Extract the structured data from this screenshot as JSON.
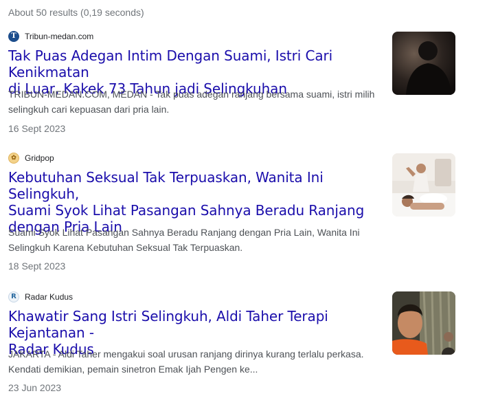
{
  "stats": "About 50 results (0,19 seconds)",
  "results": [
    {
      "favicon_letter": "T",
      "source": "Tribun-medan.com",
      "title_lines": [
        "Tak Puas Adegan Intim Dengan Suami, Istri Cari Kenikmatan",
        "di Luar, Kakek 73 Tahun jadi Selingkuhan"
      ],
      "snippet_lines": [
        "TRIBUN-MEDAN.COM, MEDAN - Tak puas adegan ranjang bersama suami, istri milih",
        "selingkuh cari kepuasan dari pria lain."
      ],
      "date": "16 Sept 2023",
      "thumbnail": "man-silhouette-photo"
    },
    {
      "favicon_letter": "✿",
      "source": "Gridpop",
      "title_lines": [
        "Kebutuhan Seksual Tak Terpuaskan, Wanita Ini Selingkuh,",
        "Suami Syok Lihat Pasangan Sahnya Beradu Ranjang",
        "dengan Pria Lain"
      ],
      "snippet_lines": [
        "Suami Syok Lihat Pasangan Sahnya Beradu Ranjang dengan Pria Lain, Wanita Ini",
        "Selingkuh Karena Kebutuhan Seksual Tak Terpuaskan."
      ],
      "date": "18 Sept 2023",
      "thumbnail": "bedroom-photo"
    },
    {
      "favicon_letter": "R",
      "source": "Radar Kudus",
      "title_lines": [
        "Khawatir Sang Istri Selingkuh, Aldi Taher Terapi Kejantanan -",
        "Radar Kudus"
      ],
      "snippet_lines": [
        "JAKARTA - Aldi Taher mengakui soal urusan ranjang dirinya kurang terlalu perkasa.",
        "Kendati demikian, pemain sinetron Emak Ijah Pengen ke..."
      ],
      "date": "23 Jun 2023",
      "thumbnail": "man-portrait-photo"
    }
  ]
}
